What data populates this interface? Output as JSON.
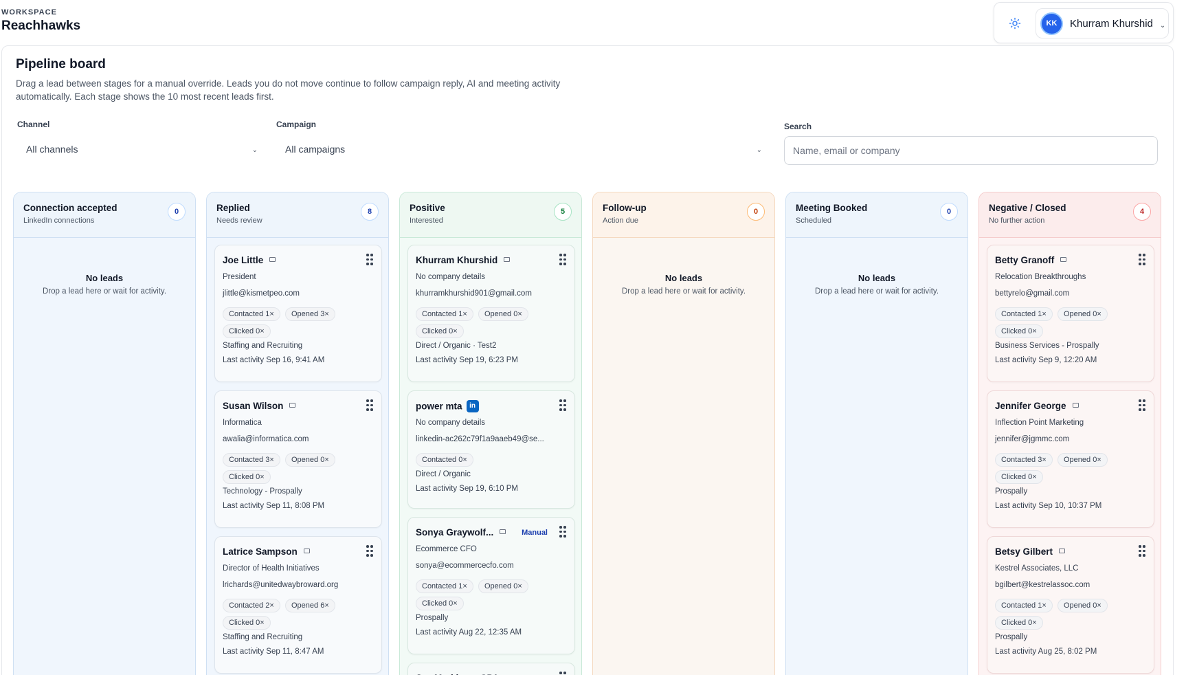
{
  "workspace": {
    "label": "WORKSPACE",
    "name": "Reachhawks"
  },
  "user": {
    "initials": "KK",
    "name": "Khurram Khurshid"
  },
  "board": {
    "title": "Pipeline board",
    "description": "Drag a lead between stages for a manual override. Leads you do not move continue to follow campaign reply, AI and meeting activity automatically. Each stage shows the 10 most recent leads first."
  },
  "filters": {
    "channel_label": "Channel",
    "channel_value": "All channels",
    "campaign_label": "Campaign",
    "campaign_value": "All campaigns",
    "search_label": "Search",
    "search_placeholder": "Name, email or company"
  },
  "colors": {
    "accent": "#2563eb",
    "linkedin": "#0a66c2"
  },
  "columns": [
    {
      "title": "Connection accepted",
      "subtitle": "LinkedIn connections",
      "count": "0",
      "tone": "blue",
      "empty_title": "No leads",
      "empty_sub": "Drop a lead here or wait for activity.",
      "cards": []
    },
    {
      "title": "Replied",
      "subtitle": "Needs review",
      "count": "8",
      "tone": "blue",
      "cards": [
        {
          "name": "Joe Little",
          "icon": "mail-icon",
          "company": "President",
          "email": "jlittle@kismetpeo.com",
          "pills": [
            "Contacted 1×",
            "Opened 3×",
            "Clicked 0×"
          ],
          "source": "Staffing and Recruiting",
          "last": "Last activity Sep 16, 9:41 AM"
        },
        {
          "name": "Susan Wilson",
          "icon": "mail-icon",
          "company": "Informatica",
          "email": "awalia@informatica.com",
          "pills": [
            "Contacted 3×",
            "Opened 0×",
            "Clicked 0×"
          ],
          "source": "Technology - Prospally",
          "last": "Last activity Sep 11, 8:08 PM"
        },
        {
          "name": "Latrice Sampson",
          "icon": "mail-icon",
          "company": "Director of Health Initiatives",
          "email": "lrichards@unitedwaybroward.org",
          "pills": [
            "Contacted 2×",
            "Opened 6×",
            "Clicked 0×"
          ],
          "source": "Staffing and Recruiting",
          "last": "Last activity Sep 11, 8:47 AM"
        }
      ]
    },
    {
      "title": "Positive",
      "subtitle": "Interested",
      "count": "5",
      "tone": "green",
      "cards": [
        {
          "name": "Khurram Khurshid",
          "icon": "mail-icon",
          "company": "No company details",
          "email": "khurramkhurshid901@gmail.com",
          "pills": [
            "Contacted 1×",
            "Opened 0×",
            "Clicked 0×"
          ],
          "source": "Direct / Organic · Test2",
          "last": "Last activity Sep 19, 6:23 PM"
        },
        {
          "name": "power mta",
          "icon": "linkedin-icon",
          "badge": "in",
          "company": "No company details",
          "email": "linkedin-ac262c79f1a9aaeb49@se...",
          "pills": [
            "Contacted 0×"
          ],
          "source": "Direct / Organic",
          "last": "Last activity Sep 19, 6:10 PM"
        },
        {
          "name": "Sonya Graywolf...",
          "icon": "mail-icon",
          "manual": "Manual",
          "company": "Ecommerce CFO",
          "email": "sonya@ecommercecfo.com",
          "pills": [
            "Contacted 1×",
            "Opened 0×",
            "Clicked 0×"
          ],
          "source": "Prospally",
          "last": "Last activity Aug 22, 12:35 AM"
        },
        {
          "name": "Joe Markiano, CPA",
          "icon": "mail-icon"
        }
      ]
    },
    {
      "title": "Follow-up",
      "subtitle": "Action due",
      "count": "0",
      "tone": "orange",
      "empty_title": "No leads",
      "empty_sub": "Drop a lead here or wait for activity.",
      "cards": []
    },
    {
      "title": "Meeting Booked",
      "subtitle": "Scheduled",
      "count": "0",
      "tone": "blue",
      "empty_title": "No leads",
      "empty_sub": "Drop a lead here or wait for activity.",
      "cards": []
    },
    {
      "title": "Negative / Closed",
      "subtitle": "No further action",
      "count": "4",
      "tone": "red",
      "cards": [
        {
          "name": "Betty Granoff",
          "icon": "mail-icon",
          "company": "Relocation Breakthroughs",
          "email": "bettyrelo@gmail.com",
          "pills": [
            "Contacted 1×",
            "Opened 0×",
            "Clicked 0×"
          ],
          "source": "Business Services - Prospally",
          "last": "Last activity Sep 9, 12:20 AM"
        },
        {
          "name": "Jennifer George",
          "icon": "mail-icon",
          "company": "Inflection Point Marketing",
          "email": "jennifer@jgmmc.com",
          "pills": [
            "Contacted 3×",
            "Opened 0×",
            "Clicked 0×"
          ],
          "source": "Prospally",
          "last": "Last activity Sep 10, 10:37 PM"
        },
        {
          "name": "Betsy Gilbert",
          "icon": "mail-icon",
          "company": "Kestrel Associates, LLC",
          "email": "bgilbert@kestrelassoc.com",
          "pills": [
            "Contacted 1×",
            "Opened 0×",
            "Clicked 0×"
          ],
          "source": "Prospally",
          "last": "Last activity Aug 25, 8:02 PM"
        }
      ]
    }
  ]
}
